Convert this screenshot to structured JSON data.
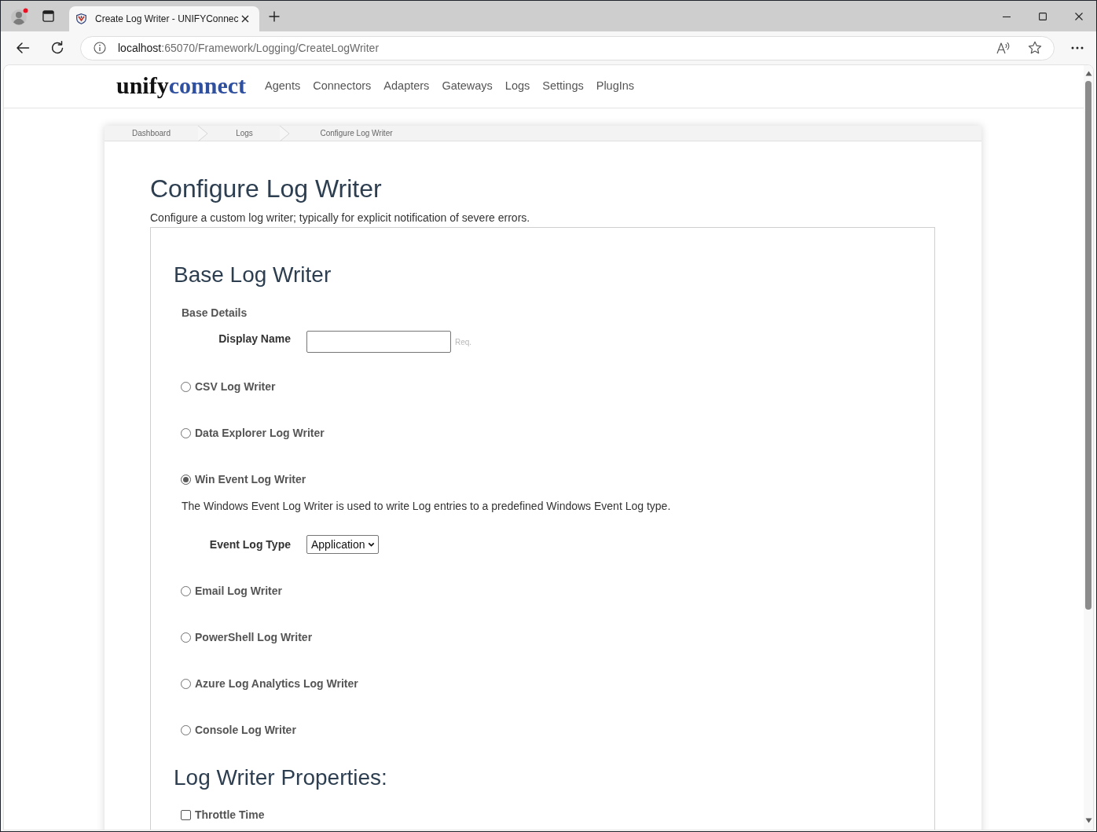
{
  "browser": {
    "tab": {
      "title": "Create Log Writer - UNIFYConnec"
    },
    "address": {
      "host": "localhost",
      "path": ":65070/Framework/Logging/CreateLogWriter"
    }
  },
  "navbar": {
    "logo": {
      "word": "unify",
      "accent_word": "connect"
    },
    "links": [
      "Agents",
      "Connectors",
      "Adapters",
      "Gateways",
      "Logs",
      "Settings",
      "PlugIns"
    ]
  },
  "breadcrumb": [
    {
      "label": "Dashboard"
    },
    {
      "label": "Logs"
    },
    {
      "label": "Configure Log Writer"
    }
  ],
  "page": {
    "title": "Configure Log Writer",
    "subtitle": "Configure a custom log writer; typically for explicit notification of severe errors."
  },
  "base_log_writer": {
    "heading": "Base Log Writer",
    "section_label": "Base Details",
    "display_name": {
      "label": "Display Name",
      "note": "Req."
    },
    "log_writers": [
      {
        "label": "CSV Log Writer",
        "selected": false
      },
      {
        "label": "Data Explorer Log Writer",
        "selected": false
      },
      {
        "label": "Win Event Log Writer",
        "selected": true,
        "description": "The Windows Event Log Writer is used to write Log entries to a predefined Windows Event Log type.",
        "setting": {
          "label": "Event Log Type",
          "value": "Application"
        }
      },
      {
        "label": "Email Log Writer",
        "selected": false
      },
      {
        "label": "PowerShell Log Writer",
        "selected": false
      },
      {
        "label": "Azure Log Analytics Log Writer",
        "selected": false
      },
      {
        "label": "Console Log Writer",
        "selected": false
      }
    ]
  },
  "properties": {
    "heading": "Log Writer Properties:",
    "options": [
      {
        "label": "Throttle Time",
        "checked": false
      }
    ]
  }
}
